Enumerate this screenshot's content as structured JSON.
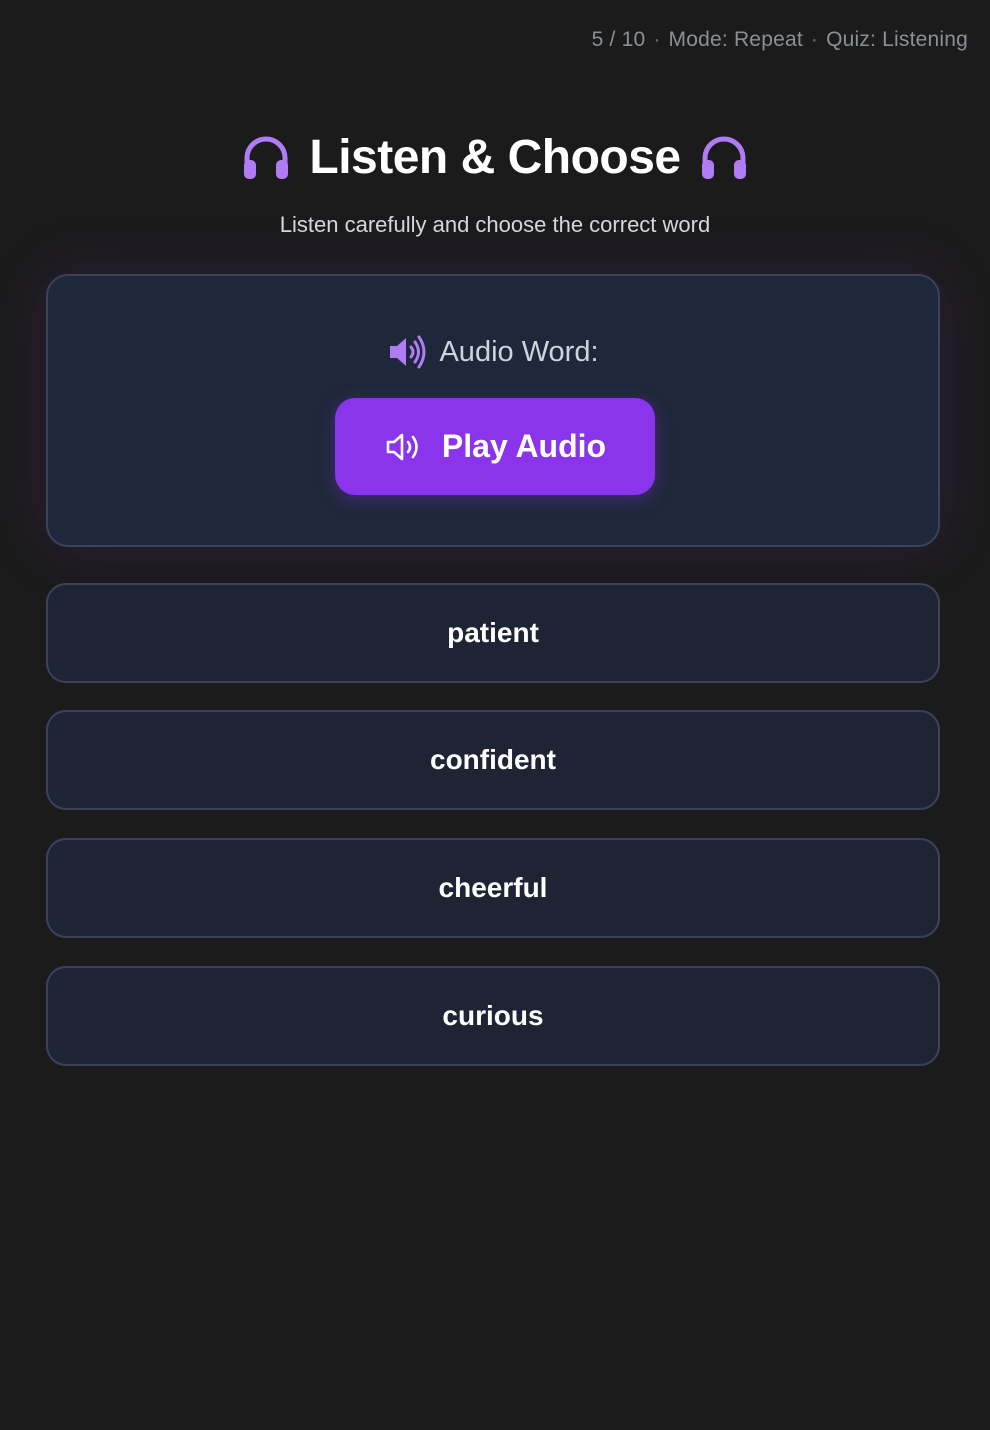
{
  "status": {
    "progress": "5 / 10",
    "mode": "Mode: Repeat",
    "quiz": "Quiz: Listening",
    "separator": "·"
  },
  "header": {
    "title": "Listen & Choose",
    "subtitle": "Listen carefully and choose the correct word",
    "icon": "headphones-icon"
  },
  "audio_card": {
    "label": "Audio Word:",
    "label_icon": "speaker-icon",
    "play_label": "Play Audio",
    "play_icon": "speaker-outline-icon"
  },
  "options": [
    {
      "label": "patient"
    },
    {
      "label": "confident"
    },
    {
      "label": "cheerful"
    },
    {
      "label": "curious"
    }
  ],
  "colors": {
    "background": "#1b1b1b",
    "accent": "#8a34ec",
    "icon_purple": "#b07cf5",
    "card": "#1f273a",
    "border": "#3a4358",
    "muted_text": "#8a8f98"
  }
}
